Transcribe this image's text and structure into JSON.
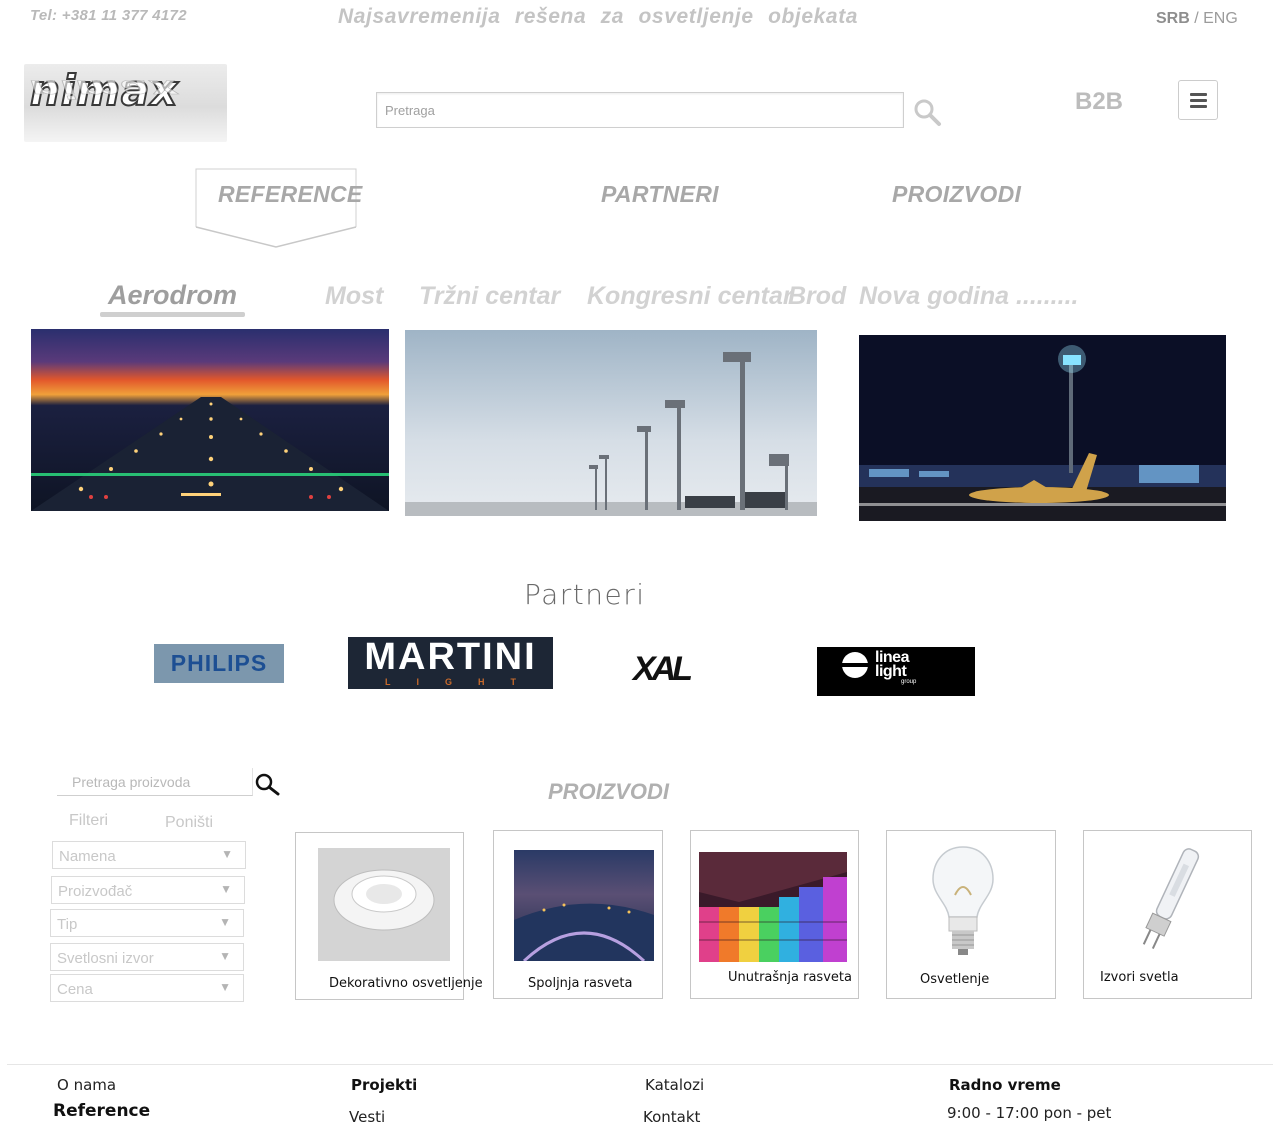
{
  "topbar": {
    "phone": "Tel: +381 11 377 4172",
    "tagline": "Najsavremenija rešena za osvetljenje objekata",
    "lang_active": "SRB",
    "lang_separator": " / ",
    "lang_other": "ENG"
  },
  "header": {
    "logo_text": "nimax",
    "search_placeholder": "Pretraga",
    "b2b_label": "B2B",
    "search_icon": "search-icon",
    "menu_icon": "hamburger-menu-icon"
  },
  "main_nav": {
    "items": [
      {
        "label": "REFERENCE",
        "active": true
      },
      {
        "label": "PARTNERI",
        "active": false
      },
      {
        "label": "PROIZVODI",
        "active": false
      }
    ]
  },
  "reference_nav": {
    "items": [
      {
        "label": "Aerodrom",
        "active": true
      },
      {
        "label": "Most",
        "active": false
      },
      {
        "label": "Tržni centar",
        "active": false
      },
      {
        "label": "Kongresni centar",
        "active": false
      },
      {
        "label": "Brod",
        "active": false
      },
      {
        "label": "Nova godina .........",
        "active": false
      }
    ]
  },
  "reference_images": [
    {
      "subject": "airport runway lights at dusk"
    },
    {
      "subject": "airport apron light masts"
    },
    {
      "subject": "airport at night with aircraft"
    }
  ],
  "partners": {
    "title": "Partneri",
    "logos": [
      {
        "name": "PHILIPS"
      },
      {
        "name": "MARTINI",
        "sub": "LIGHT"
      },
      {
        "name": "XAL"
      },
      {
        "name": "linea light",
        "line1": "linea",
        "line2": "light",
        "line3": "group"
      }
    ]
  },
  "products": {
    "search_placeholder": "Pretraga proizvoda",
    "filters_label": "Filteri",
    "reset_label": "Poništi",
    "filter_selects": [
      {
        "placeholder": "Namena"
      },
      {
        "placeholder": "Proizvođač"
      },
      {
        "placeholder": "Tip"
      },
      {
        "placeholder": "Svetlosni izvor"
      },
      {
        "placeholder": "Cena"
      }
    ],
    "title": "PROIZVODI",
    "categories": [
      {
        "label": "Dekorativno osvetljenje"
      },
      {
        "label": "Spoljnja rasveta"
      },
      {
        "label": "Unutrašnja rasveta"
      },
      {
        "label": "Osvetlenje"
      },
      {
        "label": "Izvori svetla"
      }
    ]
  },
  "footer": {
    "col1": [
      "O nama",
      "Reference"
    ],
    "col2": [
      "Projekti",
      "Vesti"
    ],
    "col3": [
      "Katalozi",
      "Kontakt"
    ],
    "col4": [
      "Radno vreme",
      "9:00 - 17:00 pon - pet"
    ]
  },
  "colors": {
    "muted_text": "#b0b0b0",
    "philips_bg": "#7c97ad",
    "philips_text": "#1d4f93",
    "martini_bg": "#1d2635"
  }
}
